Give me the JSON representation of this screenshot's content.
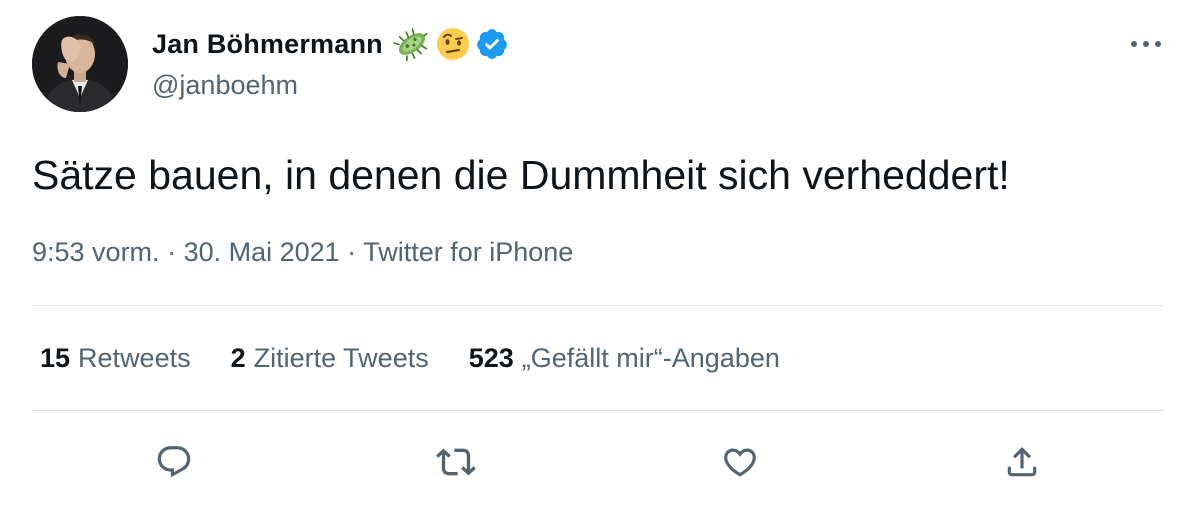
{
  "author": {
    "display_name": "Jan Böhmermann",
    "handle": "@janboehm",
    "badges": [
      "microbe-emoji",
      "face-with-raised-eyebrow-emoji",
      "verified-badge-icon"
    ]
  },
  "tweet": {
    "text": "Sätze bauen, in denen die Dummheit sich verheddert!",
    "time": "9:53 vorm.",
    "date": "30. Mai 2021",
    "source": "Twitter for iPhone",
    "separator": " · "
  },
  "stats": {
    "retweets": {
      "count": "15",
      "label": "Retweets"
    },
    "quotes": {
      "count": "2",
      "label": "Zitierte Tweets"
    },
    "likes": {
      "count": "523",
      "label": "„Gefällt mir“-Angaben"
    }
  },
  "actions": [
    "reply-icon",
    "retweet-icon",
    "like-icon",
    "share-icon"
  ],
  "colors": {
    "text_primary": "#0f1419",
    "text_secondary": "#536471",
    "verified": "#1d9bf0",
    "divider": "#e1e6ea"
  }
}
